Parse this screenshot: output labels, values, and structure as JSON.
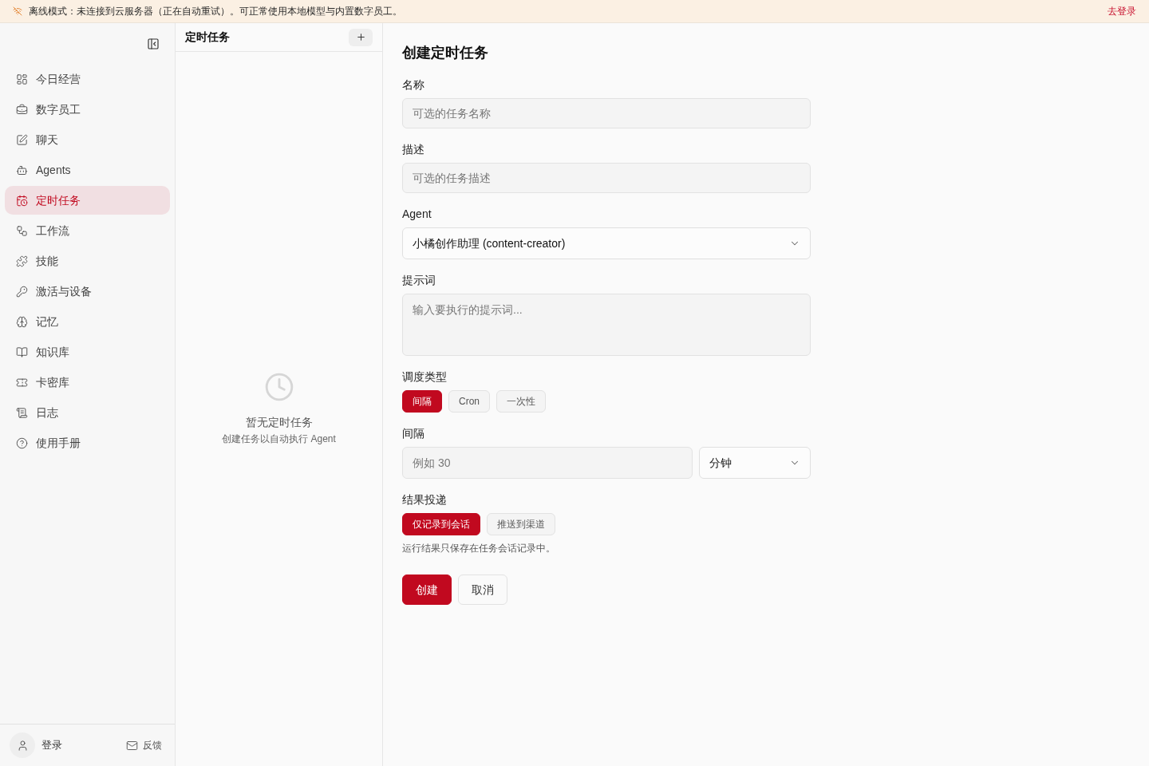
{
  "banner": {
    "message": "离线模式：未连接到云服务器（正在自动重试）。可正常使用本地模型与内置数字员工。",
    "login_link": "去登录"
  },
  "sidebar": {
    "items": [
      {
        "label": "今日经营",
        "selected": false
      },
      {
        "label": "数字员工",
        "selected": false
      },
      {
        "label": "聊天",
        "selected": false
      },
      {
        "label": "Agents",
        "selected": false
      },
      {
        "label": "定时任务",
        "selected": true
      },
      {
        "label": "工作流",
        "selected": false
      },
      {
        "label": "技能",
        "selected": false
      },
      {
        "label": "激活与设备",
        "selected": false
      },
      {
        "label": "记忆",
        "selected": false
      },
      {
        "label": "知识库",
        "selected": false
      },
      {
        "label": "卡密库",
        "selected": false
      },
      {
        "label": "日志",
        "selected": false
      },
      {
        "label": "使用手册",
        "selected": false
      }
    ],
    "footer": {
      "login": "登录",
      "feedback": "反馈"
    }
  },
  "task_list": {
    "title": "定时任务",
    "empty_title": "暂无定时任务",
    "empty_hint": "创建任务以自动执行 Agent"
  },
  "form": {
    "title": "创建定时任务",
    "fields": [
      {
        "kind": "input",
        "label": "名称",
        "placeholder": "可选的任务名称"
      },
      {
        "kind": "input",
        "label": "描述",
        "placeholder": "可选的任务描述"
      },
      {
        "kind": "select",
        "label": "Agent",
        "value": "小橘创作助理 (content-creator)"
      },
      {
        "kind": "textarea",
        "label": "提示词",
        "placeholder": "输入要执行的提示词..."
      },
      {
        "kind": "segmented",
        "label": "调度类型",
        "options": [
          {
            "label": "间隔",
            "selected": true
          },
          {
            "label": "Cron",
            "selected": false
          },
          {
            "label": "一次性",
            "selected": false
          }
        ]
      },
      {
        "kind": "interval",
        "label": "间隔",
        "placeholder": "例如 30",
        "unit": "分钟"
      },
      {
        "kind": "segmented",
        "label": "结果投递",
        "options": [
          {
            "label": "仅记录到会话",
            "selected": true
          },
          {
            "label": "推送到渠道",
            "selected": false
          }
        ],
        "note": "运行结果只保存在任务会话记录中。"
      }
    ],
    "actions": [
      {
        "label": "创建",
        "kind": "primary"
      },
      {
        "label": "取消",
        "kind": "secondary"
      }
    ]
  }
}
